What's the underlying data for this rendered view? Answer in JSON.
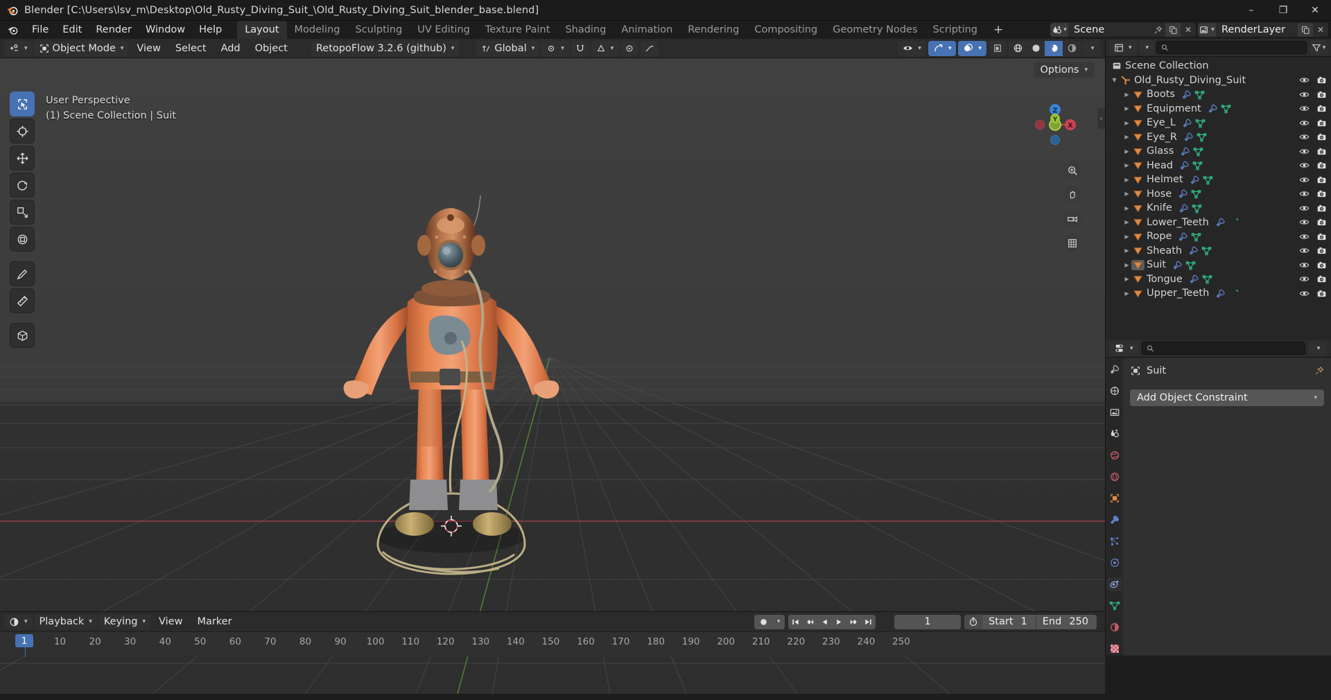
{
  "window": {
    "title": "Blender [C:\\Users\\lsv_m\\Desktop\\Old_Rusty_Diving_Suit_\\Old_Rusty_Diving_Suit_blender_base.blend]",
    "minimize": "–",
    "maximize": "❐",
    "close": "✕"
  },
  "menubar": {
    "items": [
      "File",
      "Edit",
      "Render",
      "Window",
      "Help"
    ],
    "workspaces": [
      {
        "label": "Layout",
        "active": true
      },
      {
        "label": "Modeling",
        "active": false
      },
      {
        "label": "Sculpting",
        "active": false
      },
      {
        "label": "UV Editing",
        "active": false
      },
      {
        "label": "Texture Paint",
        "active": false
      },
      {
        "label": "Shading",
        "active": false
      },
      {
        "label": "Animation",
        "active": false
      },
      {
        "label": "Rendering",
        "active": false
      },
      {
        "label": "Compositing",
        "active": false
      },
      {
        "label": "Geometry Nodes",
        "active": false
      },
      {
        "label": "Scripting",
        "active": false
      }
    ],
    "add_workspace": "+",
    "scene_name": "Scene",
    "viewlayer_name": "RenderLayer"
  },
  "viewport_header": {
    "mode": "Object Mode",
    "menus": [
      "View",
      "Select",
      "Add",
      "Object"
    ],
    "addon_menu": "RetopoFlow 3.2.6 (github)",
    "transform_orientation": "Global",
    "options": "Options"
  },
  "viewport": {
    "perspective_label": "User Perspective",
    "collection_label": "(1) Scene Collection | Suit",
    "gizmo_axes": [
      "X",
      "Y",
      "Z"
    ]
  },
  "outliner": {
    "search_placeholder": "",
    "scene_collection": "Scene Collection",
    "root": "Old_Rusty_Diving_Suit",
    "items": [
      {
        "name": "Boots",
        "modifier": true,
        "mesh": true,
        "selected": false
      },
      {
        "name": "Equipment",
        "modifier": true,
        "mesh": true,
        "selected": false
      },
      {
        "name": "Eye_L",
        "modifier": true,
        "mesh": true,
        "selected": false
      },
      {
        "name": "Eye_R",
        "modifier": true,
        "mesh": true,
        "selected": false
      },
      {
        "name": "Glass",
        "modifier": true,
        "mesh": true,
        "selected": false
      },
      {
        "name": "Head",
        "modifier": true,
        "mesh": true,
        "selected": false
      },
      {
        "name": "Helmet",
        "modifier": true,
        "mesh": true,
        "selected": false
      },
      {
        "name": "Hose",
        "modifier": true,
        "mesh": true,
        "selected": false
      },
      {
        "name": "Knife",
        "modifier": true,
        "mesh": true,
        "selected": false
      },
      {
        "name": "Lower_Teeth",
        "modifier": true,
        "mesh": "partial",
        "selected": false
      },
      {
        "name": "Rope",
        "modifier": true,
        "mesh": true,
        "selected": false
      },
      {
        "name": "Sheath",
        "modifier": true,
        "mesh": true,
        "selected": false
      },
      {
        "name": "Suit",
        "modifier": true,
        "mesh": true,
        "selected": true
      },
      {
        "name": "Tongue",
        "modifier": true,
        "mesh": true,
        "selected": false
      },
      {
        "name": "Upper_Teeth",
        "modifier": true,
        "mesh": "partial",
        "selected": false
      }
    ]
  },
  "properties": {
    "search_placeholder": "",
    "breadcrumb_object": "Suit",
    "add_constraint_label": "Add Object Constraint",
    "tabs": [
      {
        "name": "tool",
        "active": false
      },
      {
        "name": "render",
        "active": false
      },
      {
        "name": "output",
        "active": false
      },
      {
        "name": "view-layer",
        "active": false
      },
      {
        "name": "scene",
        "active": false
      },
      {
        "name": "world",
        "active": false
      },
      {
        "name": "object",
        "active": false
      },
      {
        "name": "modifiers",
        "active": false
      },
      {
        "name": "particles",
        "active": false
      },
      {
        "name": "physics",
        "active": false
      },
      {
        "name": "constraints",
        "active": true
      },
      {
        "name": "data",
        "active": false
      },
      {
        "name": "material",
        "active": false
      },
      {
        "name": "texture",
        "active": false
      }
    ]
  },
  "timeline": {
    "menus": [
      "Playback",
      "Keying",
      "View",
      "Marker"
    ],
    "current_frame": "1",
    "start_label": "Start",
    "start_value": "1",
    "end_label": "End",
    "end_value": "250",
    "ticks": [
      "1",
      "10",
      "20",
      "30",
      "40",
      "50",
      "60",
      "70",
      "80",
      "90",
      "100",
      "110",
      "120",
      "130",
      "140",
      "150",
      "160",
      "170",
      "180",
      "190",
      "200",
      "210",
      "220",
      "230",
      "240",
      "250"
    ]
  },
  "colors": {
    "accent_blue": "#4772b3",
    "outliner_mesh_orange": "#e08a44",
    "mesh_data_green": "#2fb584",
    "modifier_blue": "#5f80c8",
    "axis_x_red": "#cc4452",
    "axis_y_green": "#9ac238",
    "axis_z_blue": "#3b83d4"
  }
}
